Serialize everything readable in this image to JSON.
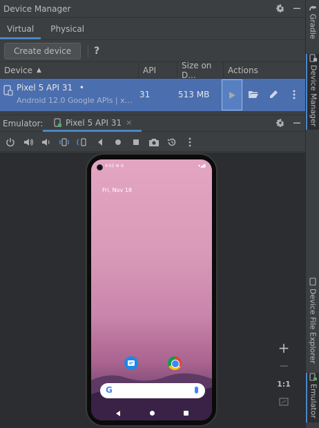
{
  "panel": {
    "title": "Device Manager",
    "tabs": [
      {
        "label": "Virtual",
        "active": true
      },
      {
        "label": "Physical",
        "active": false
      }
    ],
    "create_button": "Create device",
    "help_label": "?"
  },
  "table": {
    "columns": [
      "Device",
      "API",
      "Size on D...",
      "Actions"
    ],
    "sort_indicator": "▲",
    "rows": [
      {
        "name": "Pixel 5 API 31",
        "status_dot": "•",
        "subtitle": "Android 12.0 Google APIs | x86...",
        "api": "31",
        "size": "513 MB"
      }
    ]
  },
  "emulator": {
    "label": "Emulator:",
    "tab_label": "Pixel 5 API 31",
    "tab_close": "×",
    "zoom_plus": "+",
    "zoom_minus": "−",
    "zoom_reset": "1:1"
  },
  "phone": {
    "status_left": "4:52 ⚙ G",
    "status_right": "▾◢▮",
    "date": "Fri, Nov 18",
    "search_logo": "G"
  },
  "right_strip": {
    "tabs": [
      "Gradle",
      "Device Manager",
      "Device File Explorer",
      "Emulator"
    ]
  },
  "colors": {
    "accent": "#4a88c7",
    "selection": "#4b6eaf",
    "panel_bg": "#3c3f41"
  }
}
